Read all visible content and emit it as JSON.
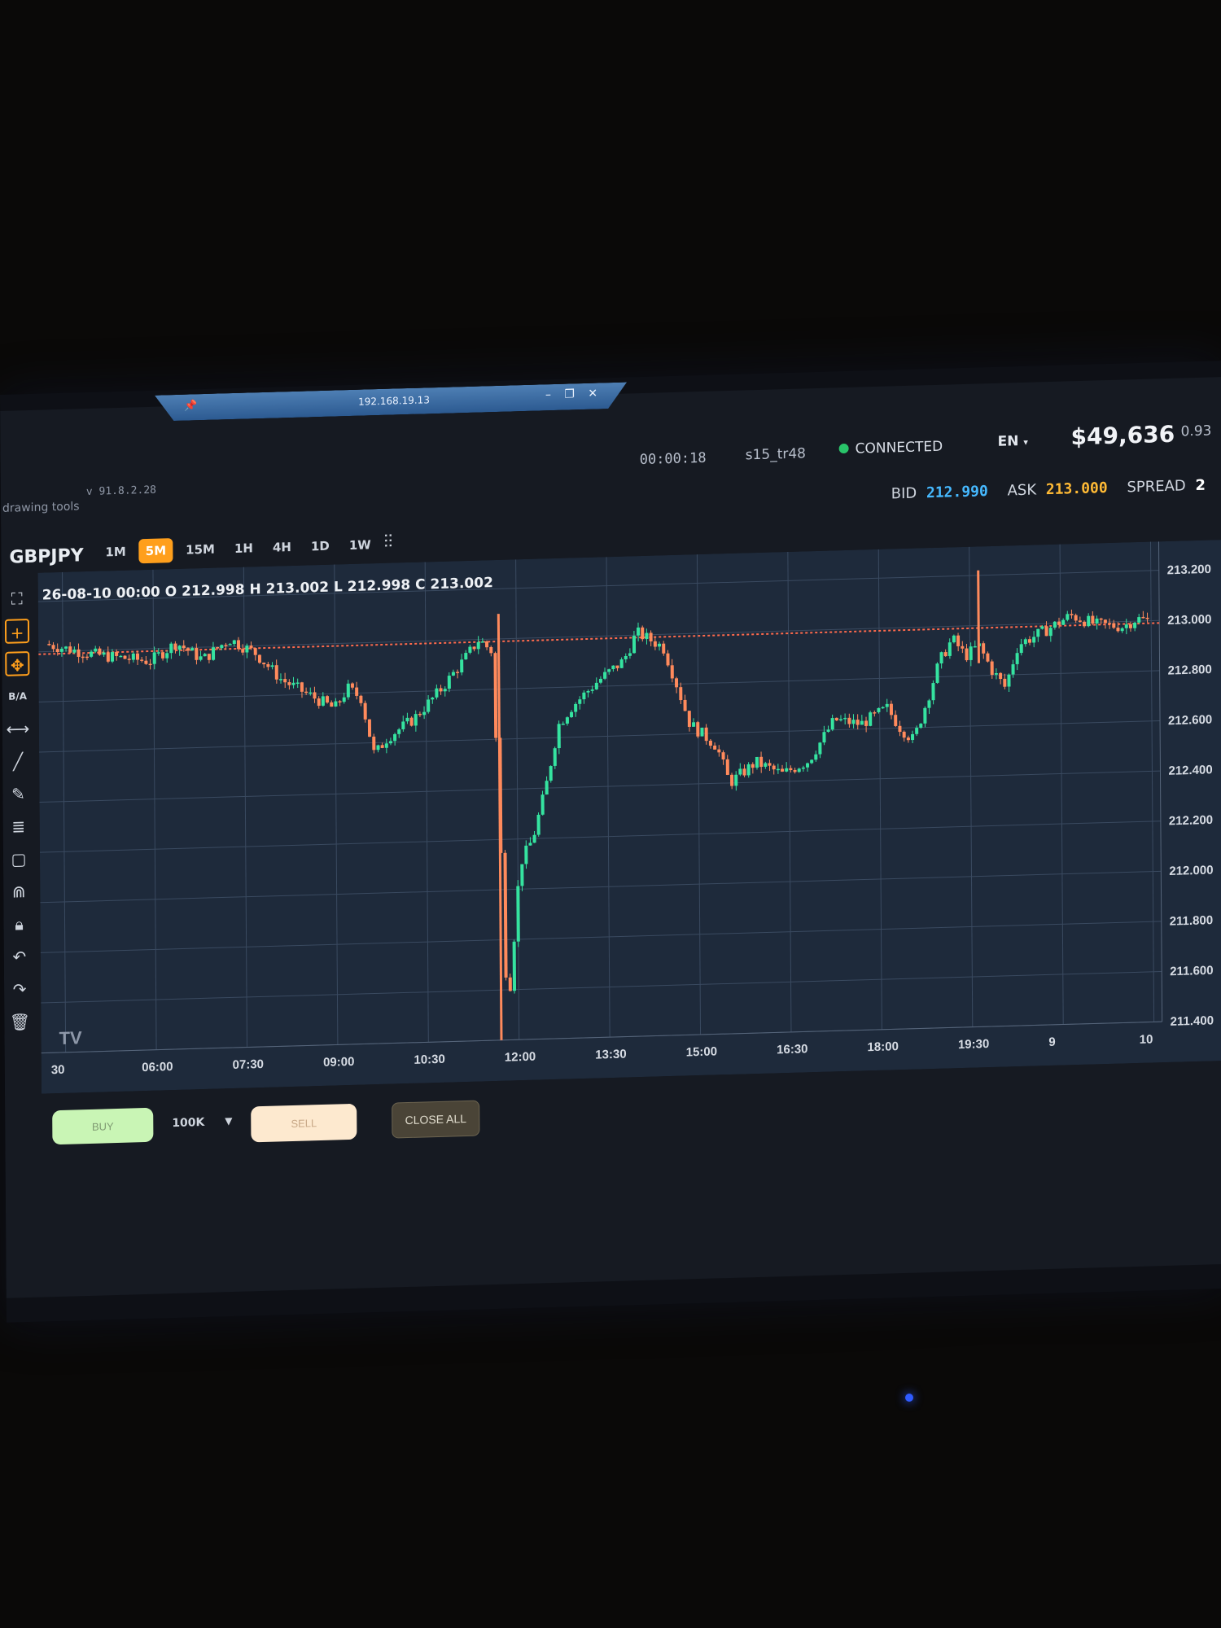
{
  "remote_session": {
    "ip": "192.168.19.13",
    "pin_icon": "pin-icon",
    "controls": "– ❐ ✕"
  },
  "header": {
    "timer": "00:00:18",
    "session": "s15_tr48",
    "connection": "CONNECTED",
    "language": "EN",
    "balance": "$49,636",
    "extra": "0.93",
    "version": "v 91.8.2.28",
    "drawing_tools": "drawing tools"
  },
  "quotes": {
    "bid_label": "BID",
    "bid": "212.990",
    "ask_label": "ASK",
    "ask": "213.000",
    "spread_label": "SPREAD",
    "spread": "2"
  },
  "toolbar": {
    "symbol": "GBPJPY",
    "timeframes": [
      "1M",
      "5M",
      "15M",
      "1H",
      "4H",
      "1D",
      "1W"
    ],
    "active_timeframe": "5M"
  },
  "ohlc_readout": "26-08-10 00:00 O 212.998 H 213.002 L 212.998 C 213.002",
  "bottom": {
    "buy": "BUY",
    "quantity": "100K",
    "sell": "SELL",
    "close_all": "CLOSE ALL"
  },
  "colors": {
    "up": "#35e3a0",
    "down": "#ff8a5c",
    "accent": "#ff9f1c",
    "bid": "#46b9ff",
    "ask": "#ffba35"
  },
  "chart_data": {
    "type": "candlestick",
    "y_ticks": [
      "213.200",
      "213.000",
      "212.800",
      "212.600",
      "212.400",
      "212.200",
      "212.000",
      "211.800",
      "211.600",
      "211.400"
    ],
    "ylim": [
      211.4,
      213.25
    ],
    "x_ticks": [
      "30",
      "06:00",
      "07:30",
      "09:00",
      "10:30",
      "12:00",
      "13:30",
      "15:00",
      "16:30",
      "18:00",
      "19:30",
      "9",
      "10"
    ],
    "price_line": 212.99,
    "watermark": "TV",
    "path": [
      [
        0,
        213.03
      ],
      [
        4,
        212.98
      ],
      [
        8,
        212.95
      ],
      [
        10,
        213.02
      ],
      [
        12,
        212.95
      ],
      [
        14,
        213.03
      ],
      [
        16,
        212.97
      ],
      [
        18,
        212.86
      ],
      [
        20,
        212.8
      ],
      [
        22,
        212.74
      ],
      [
        23,
        212.82
      ],
      [
        24,
        212.78
      ],
      [
        25,
        212.55
      ],
      [
        26,
        212.62
      ],
      [
        28,
        212.69
      ],
      [
        30,
        212.8
      ],
      [
        32,
        212.93
      ],
      [
        33,
        213.0
      ],
      [
        34,
        212.95
      ],
      [
        35,
        211.5
      ],
      [
        36,
        212.1
      ],
      [
        37,
        212.2
      ],
      [
        38,
        212.4
      ],
      [
        39,
        212.65
      ],
      [
        40,
        212.72
      ],
      [
        42,
        212.82
      ],
      [
        44,
        212.9
      ],
      [
        45,
        213.01
      ],
      [
        47,
        212.95
      ],
      [
        48,
        212.8
      ],
      [
        49,
        212.64
      ],
      [
        51,
        212.55
      ],
      [
        52,
        212.4
      ],
      [
        54,
        212.48
      ],
      [
        56,
        212.43
      ],
      [
        58,
        212.48
      ],
      [
        60,
        212.64
      ],
      [
        62,
        212.62
      ],
      [
        64,
        212.68
      ],
      [
        65,
        212.6
      ],
      [
        66,
        212.55
      ],
      [
        67,
        212.7
      ],
      [
        68,
        212.86
      ],
      [
        69,
        212.95
      ],
      [
        70,
        212.88
      ],
      [
        71,
        212.92
      ],
      [
        72,
        212.82
      ],
      [
        73,
        212.75
      ],
      [
        74,
        212.92
      ],
      [
        76,
        212.97
      ],
      [
        78,
        213.03
      ],
      [
        80,
        212.99
      ],
      [
        82,
        212.98
      ],
      [
        83,
        213.01
      ],
      [
        84,
        213.0
      ]
    ],
    "spikes": [
      {
        "at": 34.5,
        "high": 213.1,
        "low": 211.4,
        "dir": "down"
      },
      {
        "at": 71,
        "high": 213.22,
        "low": 212.85,
        "dir": "down"
      }
    ]
  }
}
